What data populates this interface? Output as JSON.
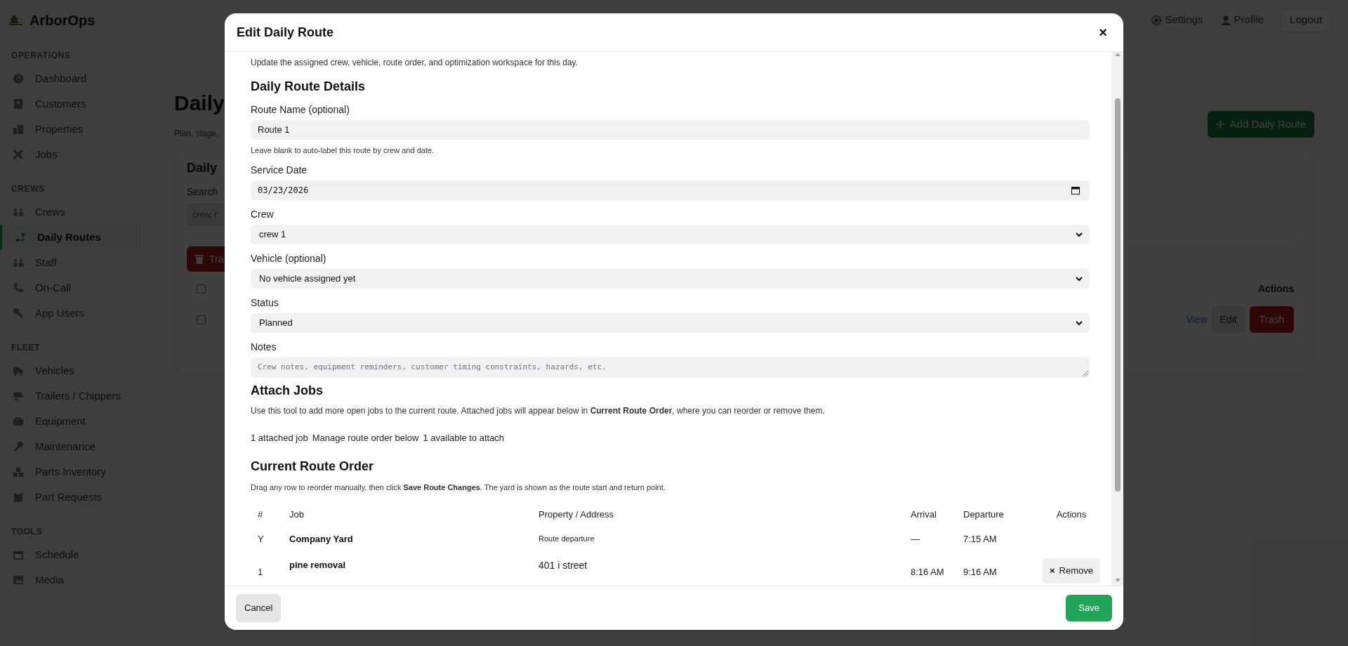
{
  "app": {
    "brand": "ArborOps",
    "nav": [
      {
        "title": "OPERATIONS",
        "items": [
          {
            "label": "Dashboard",
            "selected": false
          },
          {
            "label": "Customers",
            "selected": false
          },
          {
            "label": "Properties",
            "selected": false
          },
          {
            "label": "Jobs",
            "selected": false
          }
        ]
      },
      {
        "title": "CREWS",
        "items": [
          {
            "label": "Crews",
            "selected": false
          },
          {
            "label": "Daily Routes",
            "selected": true
          },
          {
            "label": "Staff",
            "selected": false
          },
          {
            "label": "On-Call",
            "selected": false
          },
          {
            "label": "App Users",
            "selected": false
          }
        ]
      },
      {
        "title": "FLEET",
        "items": [
          {
            "label": "Vehicles",
            "selected": false
          },
          {
            "label": "Trailers / Chippers",
            "selected": false
          },
          {
            "label": "Equipment",
            "selected": false
          },
          {
            "label": "Maintenance",
            "selected": false
          },
          {
            "label": "Parts Inventory",
            "selected": false
          },
          {
            "label": "Part Requests",
            "selected": false
          }
        ]
      },
      {
        "title": "TOOLS",
        "items": [
          {
            "label": "Schedule",
            "selected": false
          },
          {
            "label": "Media",
            "selected": false
          }
        ]
      }
    ],
    "topbar": {
      "links": [
        "Settings",
        "Profile"
      ],
      "logout": "Logout"
    },
    "page": {
      "title": "Daily",
      "subtitle": "Plan, stage,",
      "add_button": "Add Daily Route",
      "card": {
        "title": "Daily",
        "search_label": "Search",
        "search_placeholder": "crew, r",
        "trash_button": "Tra",
        "actions_header": "Actions",
        "header_checked": false,
        "rows": [
          {
            "checked": false,
            "view": "View",
            "edit": "Edit",
            "trash": "Trash"
          }
        ]
      }
    }
  },
  "modal": {
    "title": "Edit Daily Route",
    "close": "×",
    "intro": "Update the assigned crew, vehicle, route order, and optimization workspace for this day.",
    "section_title": "Daily Route Details",
    "fields": [
      {
        "kind": "text",
        "label": "Route Name (optional)",
        "value": "Route 1",
        "help": "Leave blank to auto-label this route by crew and date."
      },
      {
        "kind": "date",
        "label": "Service Date",
        "value": "03/23/2026"
      },
      {
        "kind": "select",
        "label": "Crew",
        "value": "crew 1"
      },
      {
        "kind": "select",
        "label": "Vehicle (optional)",
        "value": "No vehicle assigned yet"
      },
      {
        "kind": "select",
        "label": "Status",
        "value": "Planned"
      },
      {
        "kind": "textarea",
        "label": "Notes",
        "placeholder": "Crew notes, equipment reminders, customer timing constraints, hazards, etc."
      }
    ],
    "attach": {
      "title": "Attach Jobs",
      "text": "Use this tool to add more open jobs to the current route. Attached jobs will appear below in **Current Route Order**, where you can reorder or remove them.",
      "stats": [
        "1 attached job",
        "Manage route order below",
        "1 available to attach"
      ]
    },
    "route_order": {
      "title": "Current Route Order",
      "text": "Drag any row to reorder manually, then click **Save Route Changes**. The yard is shown as the route start and return point.",
      "columns": [
        "#",
        "Job",
        "Property / Address",
        "Arrival",
        "Departure",
        "Actions"
      ],
      "rows": [
        {
          "kind": "yard",
          "num": "Y",
          "job": "Company Yard",
          "address": "Route departure",
          "arrival": "—",
          "departure": "7:15 AM"
        },
        {
          "kind": "stop",
          "num": "1",
          "job": "pine removal",
          "address": "401 i street",
          "arrival": "8:16 AM",
          "departure": "9:16 AM",
          "action": "Remove",
          "action_icon": "×"
        }
      ]
    },
    "footer": {
      "cancel": "Cancel",
      "save": "Save"
    }
  }
}
